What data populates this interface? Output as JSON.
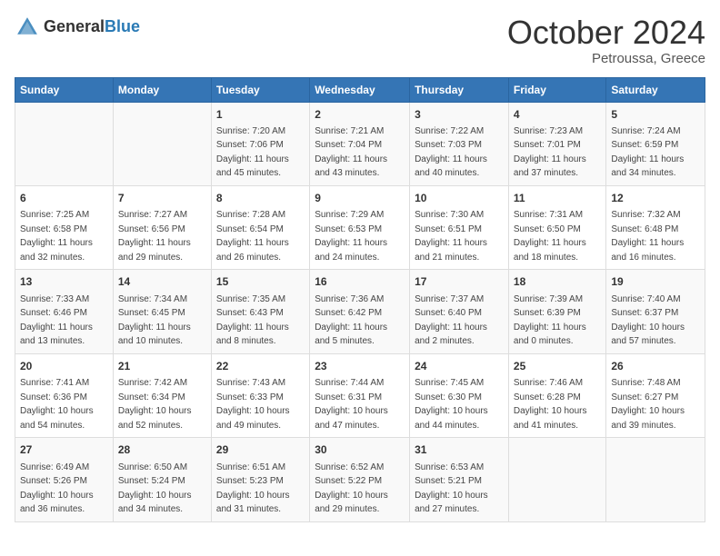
{
  "header": {
    "logo_general": "General",
    "logo_blue": "Blue",
    "month": "October 2024",
    "location": "Petroussa, Greece"
  },
  "weekdays": [
    "Sunday",
    "Monday",
    "Tuesday",
    "Wednesday",
    "Thursday",
    "Friday",
    "Saturday"
  ],
  "weeks": [
    [
      {
        "day": "",
        "info": ""
      },
      {
        "day": "",
        "info": ""
      },
      {
        "day": "1",
        "info": "Sunrise: 7:20 AM\nSunset: 7:06 PM\nDaylight: 11 hours and 45 minutes."
      },
      {
        "day": "2",
        "info": "Sunrise: 7:21 AM\nSunset: 7:04 PM\nDaylight: 11 hours and 43 minutes."
      },
      {
        "day": "3",
        "info": "Sunrise: 7:22 AM\nSunset: 7:03 PM\nDaylight: 11 hours and 40 minutes."
      },
      {
        "day": "4",
        "info": "Sunrise: 7:23 AM\nSunset: 7:01 PM\nDaylight: 11 hours and 37 minutes."
      },
      {
        "day": "5",
        "info": "Sunrise: 7:24 AM\nSunset: 6:59 PM\nDaylight: 11 hours and 34 minutes."
      }
    ],
    [
      {
        "day": "6",
        "info": "Sunrise: 7:25 AM\nSunset: 6:58 PM\nDaylight: 11 hours and 32 minutes."
      },
      {
        "day": "7",
        "info": "Sunrise: 7:27 AM\nSunset: 6:56 PM\nDaylight: 11 hours and 29 minutes."
      },
      {
        "day": "8",
        "info": "Sunrise: 7:28 AM\nSunset: 6:54 PM\nDaylight: 11 hours and 26 minutes."
      },
      {
        "day": "9",
        "info": "Sunrise: 7:29 AM\nSunset: 6:53 PM\nDaylight: 11 hours and 24 minutes."
      },
      {
        "day": "10",
        "info": "Sunrise: 7:30 AM\nSunset: 6:51 PM\nDaylight: 11 hours and 21 minutes."
      },
      {
        "day": "11",
        "info": "Sunrise: 7:31 AM\nSunset: 6:50 PM\nDaylight: 11 hours and 18 minutes."
      },
      {
        "day": "12",
        "info": "Sunrise: 7:32 AM\nSunset: 6:48 PM\nDaylight: 11 hours and 16 minutes."
      }
    ],
    [
      {
        "day": "13",
        "info": "Sunrise: 7:33 AM\nSunset: 6:46 PM\nDaylight: 11 hours and 13 minutes."
      },
      {
        "day": "14",
        "info": "Sunrise: 7:34 AM\nSunset: 6:45 PM\nDaylight: 11 hours and 10 minutes."
      },
      {
        "day": "15",
        "info": "Sunrise: 7:35 AM\nSunset: 6:43 PM\nDaylight: 11 hours and 8 minutes."
      },
      {
        "day": "16",
        "info": "Sunrise: 7:36 AM\nSunset: 6:42 PM\nDaylight: 11 hours and 5 minutes."
      },
      {
        "day": "17",
        "info": "Sunrise: 7:37 AM\nSunset: 6:40 PM\nDaylight: 11 hours and 2 minutes."
      },
      {
        "day": "18",
        "info": "Sunrise: 7:39 AM\nSunset: 6:39 PM\nDaylight: 11 hours and 0 minutes."
      },
      {
        "day": "19",
        "info": "Sunrise: 7:40 AM\nSunset: 6:37 PM\nDaylight: 10 hours and 57 minutes."
      }
    ],
    [
      {
        "day": "20",
        "info": "Sunrise: 7:41 AM\nSunset: 6:36 PM\nDaylight: 10 hours and 54 minutes."
      },
      {
        "day": "21",
        "info": "Sunrise: 7:42 AM\nSunset: 6:34 PM\nDaylight: 10 hours and 52 minutes."
      },
      {
        "day": "22",
        "info": "Sunrise: 7:43 AM\nSunset: 6:33 PM\nDaylight: 10 hours and 49 minutes."
      },
      {
        "day": "23",
        "info": "Sunrise: 7:44 AM\nSunset: 6:31 PM\nDaylight: 10 hours and 47 minutes."
      },
      {
        "day": "24",
        "info": "Sunrise: 7:45 AM\nSunset: 6:30 PM\nDaylight: 10 hours and 44 minutes."
      },
      {
        "day": "25",
        "info": "Sunrise: 7:46 AM\nSunset: 6:28 PM\nDaylight: 10 hours and 41 minutes."
      },
      {
        "day": "26",
        "info": "Sunrise: 7:48 AM\nSunset: 6:27 PM\nDaylight: 10 hours and 39 minutes."
      }
    ],
    [
      {
        "day": "27",
        "info": "Sunrise: 6:49 AM\nSunset: 5:26 PM\nDaylight: 10 hours and 36 minutes."
      },
      {
        "day": "28",
        "info": "Sunrise: 6:50 AM\nSunset: 5:24 PM\nDaylight: 10 hours and 34 minutes."
      },
      {
        "day": "29",
        "info": "Sunrise: 6:51 AM\nSunset: 5:23 PM\nDaylight: 10 hours and 31 minutes."
      },
      {
        "day": "30",
        "info": "Sunrise: 6:52 AM\nSunset: 5:22 PM\nDaylight: 10 hours and 29 minutes."
      },
      {
        "day": "31",
        "info": "Sunrise: 6:53 AM\nSunset: 5:21 PM\nDaylight: 10 hours and 27 minutes."
      },
      {
        "day": "",
        "info": ""
      },
      {
        "day": "",
        "info": ""
      }
    ]
  ]
}
